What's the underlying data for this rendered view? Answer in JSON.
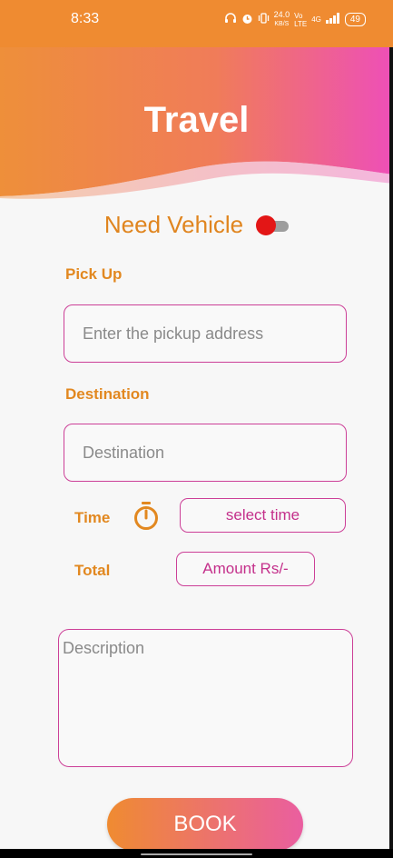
{
  "status_bar": {
    "time": "8:33",
    "speed_value": "24.0",
    "speed_unit": "KB/S",
    "network": "4G",
    "battery": "49"
  },
  "header": {
    "title": "Travel",
    "gradient_start": "#ef8b31",
    "gradient_end": "#ee4fb5"
  },
  "need_vehicle": {
    "label": "Need Vehicle",
    "toggle_on": false
  },
  "pickup": {
    "label": "Pick Up",
    "placeholder": "Enter the pickup address"
  },
  "destination": {
    "label": "Destination",
    "placeholder": "Destination"
  },
  "time": {
    "label": "Time",
    "icon": "stopwatch-icon",
    "button_label": "select time"
  },
  "total": {
    "label": "Total",
    "amount_label": "Amount Rs/-"
  },
  "description": {
    "placeholder": "Description"
  },
  "book_button": {
    "label": "BOOK"
  },
  "colors": {
    "accent_orange": "#e28820",
    "accent_pink": "#cc3f97",
    "toggle_thumb": "#e31616"
  }
}
